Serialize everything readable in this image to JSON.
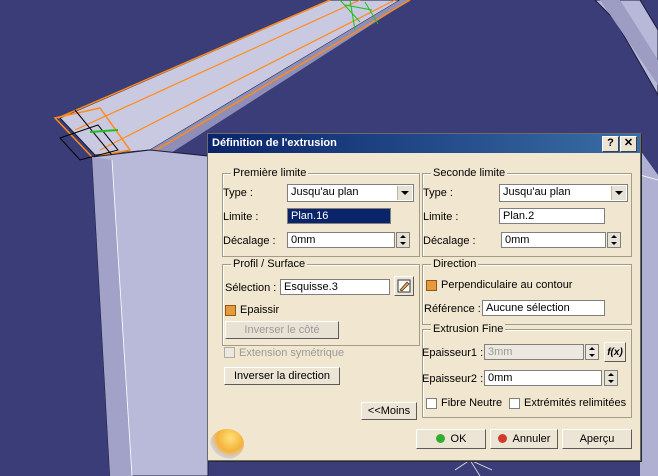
{
  "dialog": {
    "title": "Définition de l'extrusion",
    "help_label": "?",
    "close_label": "✕"
  },
  "premiere_limite": {
    "title": "Première limite",
    "type_label": "Type :",
    "type_value": "Jusqu'au plan",
    "limite_label": "Limite :",
    "limite_value": "Plan.16",
    "decalage_label": "Décalage :",
    "decalage_value": "0mm"
  },
  "seconde_limite": {
    "title": "Seconde limite",
    "type_label": "Type :",
    "type_value": "Jusqu'au plan",
    "limite_label": "Limite :",
    "limite_value": "Plan.2",
    "decalage_label": "Décalage :",
    "decalage_value": "0mm"
  },
  "profil": {
    "title": "Profil / Surface",
    "selection_label": "Sélection :",
    "selection_value": "Esquisse.3",
    "epaissir_label": "Epaissir",
    "epaissir_checked": true,
    "inverser_cote_label": "Inverser le côté"
  },
  "extension_symetrique_label": "Extension symétrique",
  "inverser_direction_label": "Inverser la direction",
  "moins_label": "<<Moins",
  "direction": {
    "title": "Direction",
    "perpendiculaire_label": "Perpendiculaire au contour",
    "perpendiculaire_checked": true,
    "reference_label": "Référence :",
    "reference_value": "Aucune sélection"
  },
  "extrusion_fine": {
    "title": "Extrusion Fine",
    "epaisseur1_label": "Epaisseur1 :",
    "epaisseur1_value": "3mm",
    "epaisseur2_label": "Epaisseur2 :",
    "epaisseur2_value": "0mm",
    "fx_label": "f(x)",
    "fibre_neutre_label": "Fibre Neutre",
    "extremites_label": "Extrémités relimitées"
  },
  "footer": {
    "ok_label": "OK",
    "annuler_label": "Annuler",
    "apercu_label": "Aperçu"
  },
  "colors": {
    "viewport_bg": "#3a3d78",
    "dialog_bg": "#f1e7d0",
    "titlebar": "#0a246a",
    "ok_dot": "#2fae2f",
    "cancel_dot": "#d13a2a",
    "highlight": "#ff8c1a"
  }
}
